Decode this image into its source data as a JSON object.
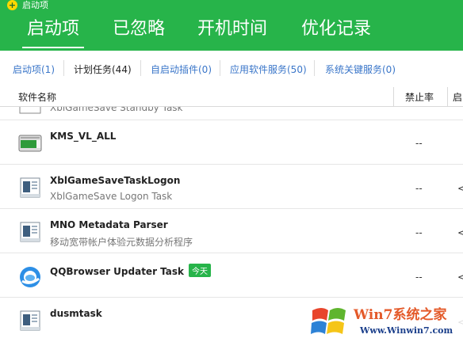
{
  "titlebar": {
    "title": "启动项"
  },
  "tabs": [
    {
      "label": "启动项",
      "active": true
    },
    {
      "label": "已忽略"
    },
    {
      "label": "开机时间"
    },
    {
      "label": "优化记录"
    }
  ],
  "subtabs": [
    {
      "label": "启动项(1)"
    },
    {
      "label": "计划任务(44)",
      "active": true
    },
    {
      "label": "自启动插件(0)"
    },
    {
      "label": "应用软件服务(50)"
    },
    {
      "label": "系统关键服务(0)"
    }
  ],
  "table": {
    "columns": [
      "软件名称",
      "禁止率",
      "启"
    ],
    "rows": [
      {
        "name": "",
        "desc": "XblGameSave Standby Task",
        "rate": "",
        "more": "",
        "icon": "task-icon"
      },
      {
        "name": "KMS_VL_ALL",
        "desc": "",
        "rate": "--",
        "more": "",
        "icon": "kms-icon"
      },
      {
        "name": "XblGameSaveTaskLogon",
        "desc": "XblGameSave Logon Task",
        "rate": "--",
        "more": "<",
        "icon": "task-icon"
      },
      {
        "name": "MNO Metadata Parser",
        "desc": "移动宽带帐户体验元数据分析程序",
        "rate": "--",
        "more": "<",
        "icon": "task-icon"
      },
      {
        "name": "QQBrowser Updater Task",
        "desc": "",
        "badge": "今天",
        "rate": "--",
        "more": "<",
        "icon": "qqbrowser-icon"
      },
      {
        "name": "dusmtask",
        "desc": "",
        "rate": "",
        "more": "<",
        "icon": "task-icon"
      }
    ]
  },
  "watermark": {
    "brand": "Win7系统之家",
    "url": "Www.Winwin7.com"
  },
  "colors": {
    "accent": "#27b44a",
    "link": "#3a76c9"
  }
}
